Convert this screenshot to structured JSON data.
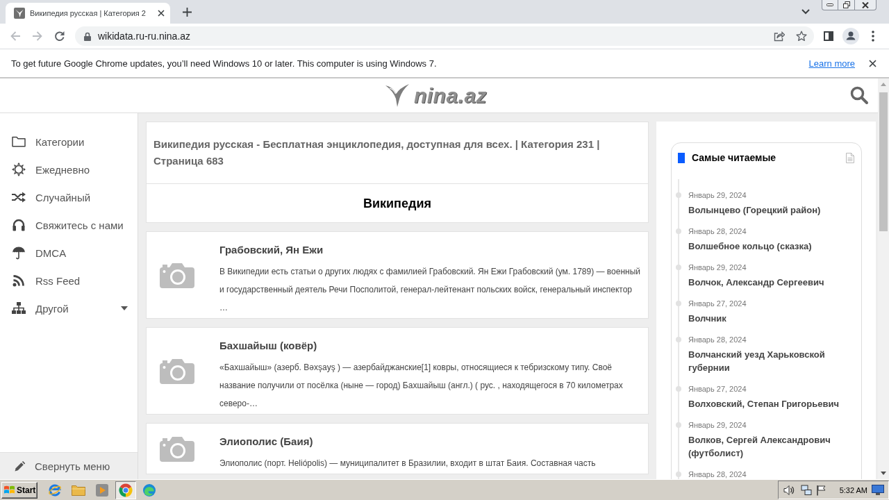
{
  "browser": {
    "tab": {
      "title": "Википедия русская | Категория 2",
      "selected": true
    },
    "toolbar": {
      "back_disabled": true,
      "forward_disabled": true,
      "url": "wikidata.ru-ru.nina.az"
    },
    "infobar": {
      "message": "To get future Google Chrome updates, you’ll need Windows 10 or later. This computer is using Windows 7.",
      "link": "Learn more"
    }
  },
  "site_header": {
    "logo": "nina.az"
  },
  "sidebar": {
    "items": [
      {
        "label": "Категории",
        "kind": "link"
      },
      {
        "label": "Ежедневно",
        "kind": "link"
      },
      {
        "label": "Случайный",
        "kind": "link"
      },
      {
        "label": "Свяжитесь с нами",
        "kind": "link"
      },
      {
        "label": "DMCA",
        "kind": "link"
      },
      {
        "label": "Rss Feed",
        "kind": "link"
      },
      {
        "label": "Другой",
        "kind": "dropdown"
      }
    ],
    "collapse": "Свернуть меню"
  },
  "main": {
    "heading": "Википедия русская - Бесплатная энциклопедия, доступная для всех. | Категория 231 | Страница 683",
    "section_title": "Википедия",
    "articles": [
      {
        "title": "Грабовский, Ян Ежи",
        "excerpt": "В Википедии есть статьи о других людях с фамилией Грабовский. Ян Ежи Грабовский (ум. 1789) — военный и государственный деятель Речи Посполитой, генерал-лейтенант польских войск, генеральный инспектор …"
      },
      {
        "title": "Бахшайыш (ковёр)",
        "excerpt": "«Бахшайыш» (азерб. Bəxşayş ) — азербайджанские[1] ковры, относящиеся к тебризскому типу. Своё название получили от посёлка (ныне — город) Бахшайыш (англ.) ( рус. , находящегося в 70 километрах северо-…"
      },
      {
        "title": "Элиополис (Баия)",
        "excerpt": "Элиополис (порт. Heliópolis) — муниципалитет в Бразилии, входит в штат Баия. Составная часть"
      }
    ]
  },
  "most_read": {
    "title": "Самые читаемые",
    "items": [
      {
        "date": "Январь 29, 2024",
        "title": "Волынцево (Горецкий район)"
      },
      {
        "date": "Январь 28, 2024",
        "title": "Волшебное кольцо (сказка)"
      },
      {
        "date": "Январь 29, 2024",
        "title": "Волчок, Александр Сергеевич"
      },
      {
        "date": "Январь 27, 2024",
        "title": "Волчник"
      },
      {
        "date": "Январь 28, 2024",
        "title": "Волчанский уезд Харьковской губернии"
      },
      {
        "date": "Январь 27, 2024",
        "title": "Волховский, Степан Григорьевич"
      },
      {
        "date": "Январь 29, 2024",
        "title": "Волков, Сергей Александрович (футболист)"
      },
      {
        "date": "Январь 28, 2024"
      }
    ]
  },
  "taskbar": {
    "start": "Start",
    "apps": [
      {
        "selected": false
      },
      {
        "selected": false
      },
      {
        "selected": false
      },
      {
        "selected": true
      },
      {
        "selected": false
      }
    ],
    "clock": "5:32 AM"
  }
}
